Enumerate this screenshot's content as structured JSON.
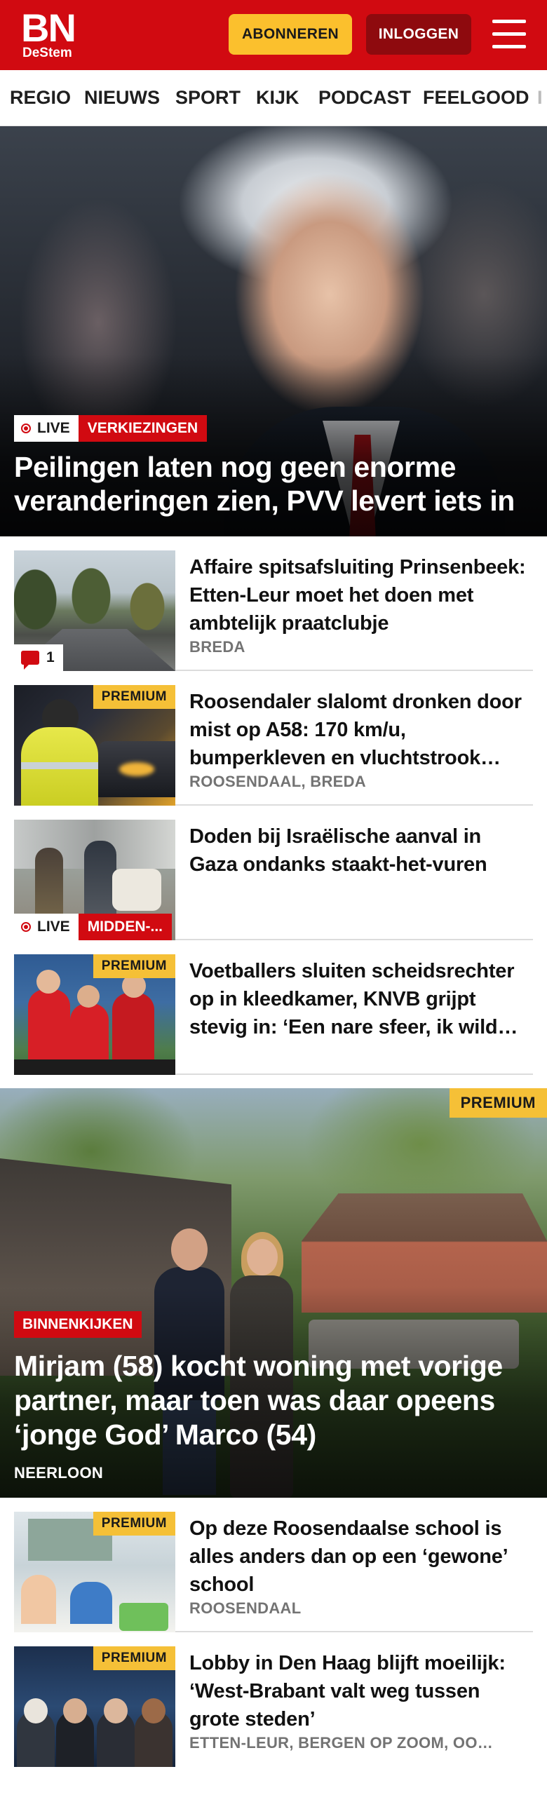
{
  "header": {
    "logo_top": "BN",
    "logo_bottom": "DeStem",
    "subscribe_label": "ABONNEREN",
    "login_label": "INLOGGEN",
    "brand_color": "#d10a11"
  },
  "nav": {
    "items": [
      "REGIO",
      "NIEUWS",
      "SPORT",
      "KIJK",
      "PODCAST",
      "FEELGOOD",
      "I"
    ]
  },
  "hero": {
    "live_label": "LIVE",
    "category": "VERKIEZINGEN",
    "title": "Peilingen laten nog geen enorme veranderingen zien, PVV levert iets in"
  },
  "articles": [
    {
      "title": "Affaire spitsafsluiting Prinsen­beek: Etten-Leur moet het doen met ambtelijk praatclubje",
      "meta": "BREDA",
      "comments": "1"
    },
    {
      "title": "Roosendaler slalomt dronken door mist op A58: 170 km/u, bumperkleven en vluchtstrook…",
      "meta": "ROOSENDAAL, BREDA",
      "badge": "PREMIUM"
    },
    {
      "title": "Doden bij Israëlische aanval in Gaza ondanks staakt-het-vuren",
      "live_label": "LIVE",
      "category": "MIDDEN-..."
    },
    {
      "title": "Voetballers sluiten scheidsrech­ter op in kleedkamer, KNVB grijpt stevig in: ‘Een nare sfeer, ik wild…",
      "badge": "PREMIUM"
    }
  ],
  "feature": {
    "badge": "PREMIUM",
    "category": "BINNENKIJKEN",
    "title": "Mirjam (58) kocht woning met vorige partner, maar toen was daar opeens ‘jonge God’ Marco (54)",
    "meta": "NEERLOON"
  },
  "articles2": [
    {
      "title": "Op deze Roosendaalse school is alles anders dan op een ‘gewone’ school",
      "meta": "ROOSENDAAL",
      "badge": "PREMIUM"
    },
    {
      "title": "Lobby in Den Haag blijft moeilijk: ‘West-Brabant valt weg tussen grote steden’",
      "meta": "ETTEN-LEUR, BERGEN OP ZOOM, OO…",
      "badge": "PREMIUM"
    }
  ]
}
